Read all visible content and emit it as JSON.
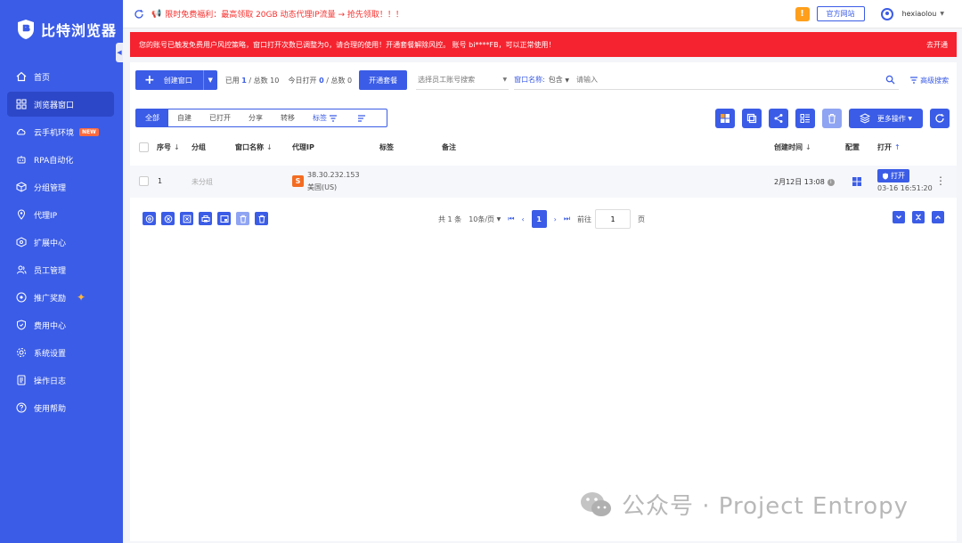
{
  "app": {
    "logo_text": "比特浏览器"
  },
  "sidebar": {
    "items": [
      {
        "label": "首页",
        "icon": "home-icon"
      },
      {
        "label": "浏览器窗口",
        "icon": "grid-icon",
        "active": true
      },
      {
        "label": "云手机环境",
        "icon": "cloud-icon",
        "badge": "NEW"
      },
      {
        "label": "RPA自动化",
        "icon": "robot-icon"
      },
      {
        "label": "分组管理",
        "icon": "cube-icon"
      },
      {
        "label": "代理IP",
        "icon": "location-icon"
      },
      {
        "label": "扩展中心",
        "icon": "puzzle-icon"
      },
      {
        "label": "员工管理",
        "icon": "users-icon"
      },
      {
        "label": "推广奖励",
        "icon": "gift-icon"
      },
      {
        "label": "费用中心",
        "icon": "shield-icon"
      },
      {
        "label": "系统设置",
        "icon": "gear-icon"
      },
      {
        "label": "操作日志",
        "icon": "log-icon"
      },
      {
        "label": "使用帮助",
        "icon": "help-icon"
      }
    ]
  },
  "topbar": {
    "promo": "限时免费福利：最高领取 20GB 动态代理IP流量 → 抢先领取！！！",
    "warn_symbol": "!",
    "official_site": "官方网站",
    "username": "hexiaolou"
  },
  "banner": {
    "text": "您的账号已触发免费用户风控策略，窗口打开次数已调整为0，请合理的使用！开通套餐解除风控。 账号 bi****FB，可以正常使用！",
    "action": "去开通"
  },
  "toolbar": {
    "create_label": "创建窗口",
    "used_prefix": "已用",
    "used": "1",
    "total_label": "/ 总数 10",
    "today_prefix": "今日打开",
    "today": "0",
    "today_total": "/ 总数 0",
    "open_package": "开通套餐",
    "staff_placeholder": "选择员工账号搜索",
    "window_name_label": "窗口名称:",
    "match_mode": "包含",
    "search_placeholder": "请输入",
    "advanced_search": "高级搜索"
  },
  "tabs": [
    "全部",
    "自建",
    "已打开",
    "分享",
    "转移",
    "标签"
  ],
  "more_actions": "更多操作",
  "table": {
    "headers": {
      "seq": "序号",
      "group": "分组",
      "window_name": "窗口名称",
      "proxy_ip": "代理IP",
      "tag": "标签",
      "note": "备注",
      "created": "创建时间",
      "config": "配置",
      "open": "打开"
    },
    "rows": [
      {
        "seq": "1",
        "group": "未分组",
        "proxy_badge": "S",
        "proxy_ip": "38.30.232.153",
        "proxy_region": "美国(US)",
        "created": "2月12日 13:08",
        "open_label": "打开",
        "last_open": "03-16 16:51:20"
      }
    ]
  },
  "pager": {
    "total": "共 1 条",
    "page_size": "10条/页",
    "current": "1",
    "goto_label": "前往",
    "goto_value": "1",
    "page_suffix": "页"
  },
  "watermark": "公众号 · Project Entropy",
  "colors": {
    "primary": "#3b5ce6",
    "danger": "#f5232f",
    "warn": "#ff9f1c"
  }
}
